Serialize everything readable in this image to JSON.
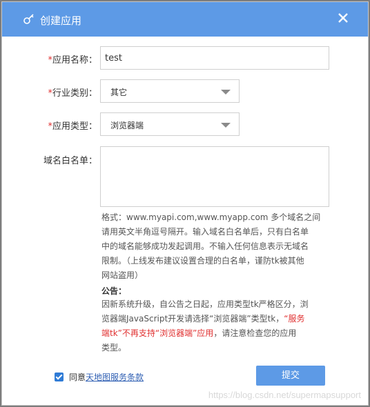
{
  "header": {
    "title": "创建应用"
  },
  "form": {
    "app_name": {
      "label_required_mark": "*",
      "label": "应用名称：",
      "value": "test"
    },
    "industry": {
      "label_required_mark": "*",
      "label": "行业类别：",
      "selected": "其它"
    },
    "app_type": {
      "label_required_mark": "*",
      "label": "应用类型：",
      "selected": "浏览器端"
    },
    "whitelist": {
      "label": "域名白名单：",
      "value": ""
    }
  },
  "help": {
    "line1": "格式：www.myapi.com,www.myapp.com 多个域名之间",
    "line2": "请用英文半角逗号隔开。输入域名白名单后，只有白名单",
    "line3": "中的域名能够成功发起调用。不输入任何信息表示无域名",
    "line4": "限制。（上线发布建议设置合理的白名单，谨防tk被其他",
    "line5": "网站盗用）"
  },
  "notice": {
    "title": "公告：",
    "line1": "因新系统升级，自公告之日起，应用类型tk严格区分，浏",
    "line2_pre": "览器端JavaScript开发请选择“浏览器端”类型tk，",
    "line2_red": "“服务",
    "line3_red": "端tk”不再支持“浏览器端”应用",
    "line3_post": "，请注意检查您的应用",
    "line4": "类型。"
  },
  "agreement": {
    "prefix": "同意",
    "link": "天地图服务条款"
  },
  "submit_label": "提交",
  "watermark": "https://blog.csdn.net/supermapsupport",
  "colors": {
    "header": "#5d9ae6",
    "required": "#e03030",
    "checkbox": "#2f7bd6"
  }
}
